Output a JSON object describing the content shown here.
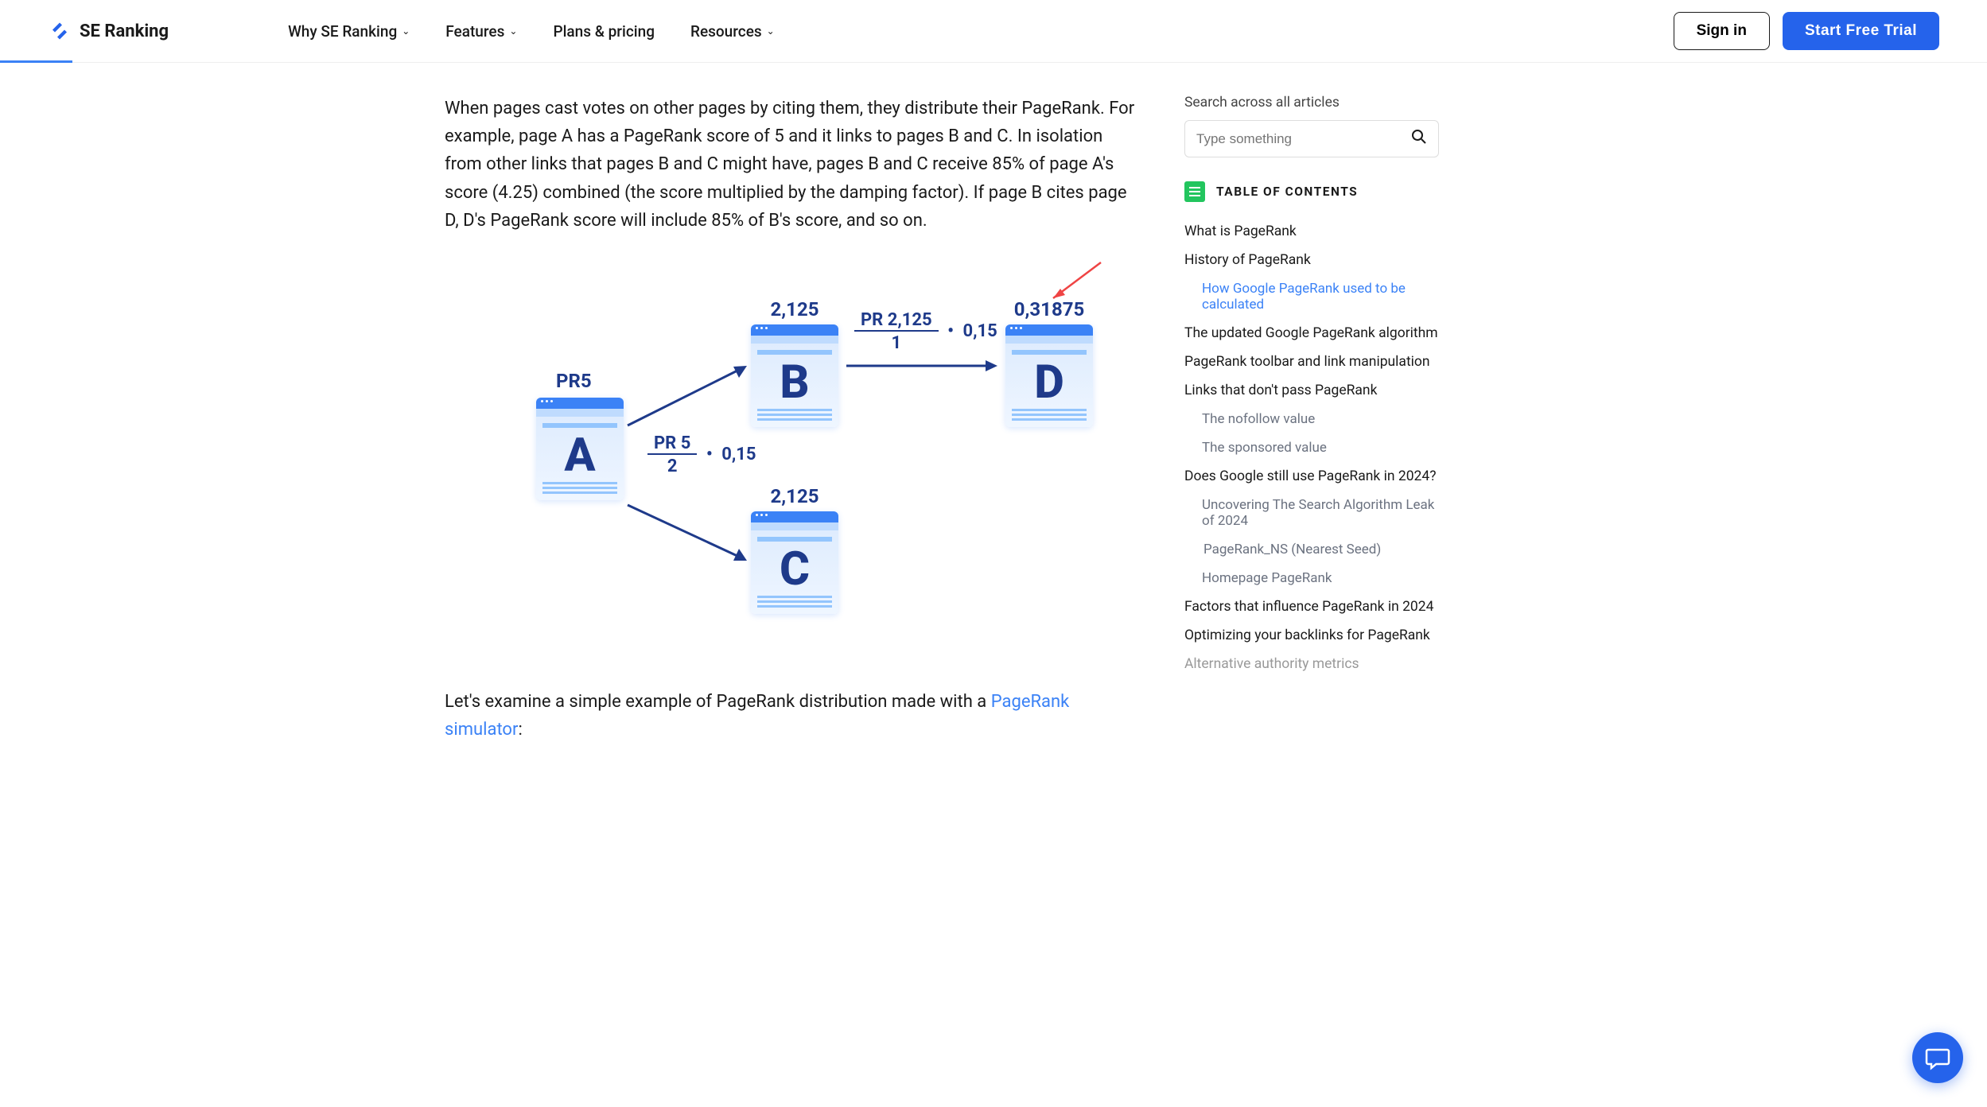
{
  "brand": "SE Ranking",
  "nav": {
    "item1": "Why SE Ranking",
    "item2": "Features",
    "item3": "Plans & pricing",
    "item4": "Resources"
  },
  "header": {
    "signin": "Sign in",
    "trial": "Start Free Trial"
  },
  "article": {
    "p1": "When pages cast votes on other pages by citing them, they distribute their PageRank. For example, page A has a PageRank score of 5 and it links to pages B and C. In isolation from other links that pages B and C might have, pages B and C receive 85% of page A's score (4.25) combined (the score multiplied by the damping factor). If page B cites page D, D's PageRank score will include 85% of B's score, and so on.",
    "p2_before": "Let's examine a simple example of PageRank distribution made with a ",
    "p2_link": "PageRank simulator",
    "p2_after": ":"
  },
  "diagram": {
    "a_label": "PR5",
    "a_letter": "A",
    "b_value": "2,125",
    "b_letter": "B",
    "c_value": "2,125",
    "c_letter": "C",
    "d_value": "0,31875",
    "d_letter": "D",
    "formula_ab_num": "PR 5",
    "formula_ab_den": "2",
    "formula_ab_factor": "0,15",
    "formula_bd_num": "PR 2,125",
    "formula_bd_den": "1",
    "formula_bd_factor": "0,15"
  },
  "sidebar": {
    "search_label": "Search across all articles",
    "search_placeholder": "Type something",
    "toc_title": "TABLE OF CONTENTS",
    "toc": {
      "i1": "What is PageRank",
      "i2": "History of PageRank",
      "i2a": "How Google PageRank used to be calculated",
      "i3": "The updated Google PageRank algorithm",
      "i4": "PageRank toolbar and link manipulation",
      "i5": "Links that don't pass PageRank",
      "i5a": "The nofollow value",
      "i5b": "The sponsored value",
      "i6": "Does Google still use PageRank in 2024?",
      "i6a": "Uncovering The Search Algorithm Leak of 2024",
      "i6b": "PageRank_NS (Nearest Seed)",
      "i6c": "Homepage PageRank",
      "i7": "Factors that influence PageRank in 2024",
      "i8": "Optimizing your backlinks for PageRank",
      "i9": "Alternative authority metrics"
    }
  }
}
